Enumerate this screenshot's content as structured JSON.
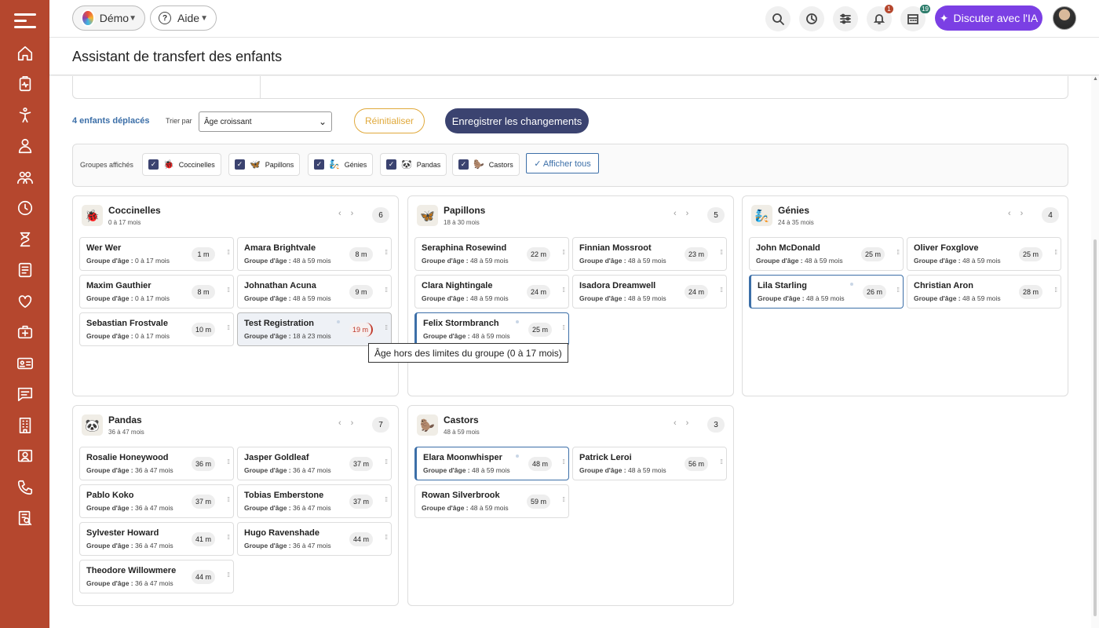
{
  "header": {
    "workspace": "Démo",
    "help": "Aide",
    "ai_button": "Discuter avec l'IA",
    "notifications_badge": "1",
    "calendar_badge": "19"
  },
  "page": {
    "title": "Assistant de transfert des enfants"
  },
  "actions": {
    "moved_count": "4 enfants déplacés",
    "sort_label": "Trier par",
    "sort_value": "Âge croissant",
    "reset": "Réinitialiser",
    "save": "Enregistrer les changements"
  },
  "filters": {
    "label": "Groupes affichés",
    "chips": [
      {
        "label": "Coccinelles",
        "emoji": "🐞"
      },
      {
        "label": "Papillons",
        "emoji": "🦋"
      },
      {
        "label": "Génies",
        "emoji": "🧞"
      },
      {
        "label": "Pandas",
        "emoji": "🐼"
      },
      {
        "label": "Castors",
        "emoji": "🦫"
      }
    ],
    "show_all": "✓ Afficher tous"
  },
  "group_prefix": "Groupe d'âge : ",
  "groups": [
    {
      "name": "Coccinelles",
      "emoji": "🐞",
      "age": "0 à 17 mois",
      "count": "6",
      "children": [
        {
          "name": "Wer Wer",
          "group": "0 à 17 mois",
          "age": "1 m"
        },
        {
          "name": "Amara Brightvale",
          "group": "48 à 59 mois",
          "age": "8 m"
        },
        {
          "name": "Maxim Gauthier",
          "group": "0 à 17 mois",
          "age": "8 m"
        },
        {
          "name": "Johnathan Acuna",
          "group": "48 à 59 mois",
          "age": "9 m"
        },
        {
          "name": "Sebastian Frostvale",
          "group": "0 à 17 mois",
          "age": "10 m"
        },
        {
          "name": "Test Registration",
          "group": "18 à 23 mois",
          "age": "19 m"
        }
      ]
    },
    {
      "name": "Papillons",
      "emoji": "🦋",
      "age": "18 à 30 mois",
      "count": "5",
      "children": [
        {
          "name": "Seraphina Rosewind",
          "group": "48 à 59 mois",
          "age": "22 m"
        },
        {
          "name": "Finnian Mossroot",
          "group": "48 à 59 mois",
          "age": "23 m"
        },
        {
          "name": "Clara Nightingale",
          "group": "48 à 59 mois",
          "age": "24 m"
        },
        {
          "name": "Isadora Dreamwell",
          "group": "48 à 59 mois",
          "age": "24 m"
        },
        {
          "name": "Felix Stormbranch",
          "group": "48 à 59 mois",
          "age": "25 m"
        }
      ]
    },
    {
      "name": "Génies",
      "emoji": "🧞",
      "age": "24 à 35 mois",
      "count": "4",
      "children": [
        {
          "name": "John McDonald",
          "group": "48 à 59 mois",
          "age": "25 m"
        },
        {
          "name": "Oliver Foxglove",
          "group": "48 à 59 mois",
          "age": "25 m"
        },
        {
          "name": "Lila Starling",
          "group": "48 à 59 mois",
          "age": "26 m"
        },
        {
          "name": "Christian Aron",
          "group": "48 à 59 mois",
          "age": "28 m"
        }
      ]
    },
    {
      "name": "Pandas",
      "emoji": "🐼",
      "age": "36 à 47 mois",
      "count": "7",
      "children": [
        {
          "name": "Rosalie Honeywood",
          "group": "36 à 47 mois",
          "age": "36 m"
        },
        {
          "name": "Jasper Goldleaf",
          "group": "36 à 47 mois",
          "age": "37 m"
        },
        {
          "name": "Pablo Koko",
          "group": "36 à 47 mois",
          "age": "37 m"
        },
        {
          "name": "Tobias Emberstone",
          "group": "36 à 47 mois",
          "age": "37 m"
        },
        {
          "name": "Sylvester Howard",
          "group": "36 à 47 mois",
          "age": "41 m"
        },
        {
          "name": "Hugo Ravenshade",
          "group": "36 à 47 mois",
          "age": "44 m"
        },
        {
          "name": "Theodore Willowmere",
          "group": "36 à 47 mois",
          "age": "44 m"
        }
      ]
    },
    {
      "name": "Castors",
      "emoji": "🦫",
      "age": "48 à 59 mois",
      "count": "3",
      "children": [
        {
          "name": "Elara Moonwhisper",
          "group": "48 à 59 mois",
          "age": "48 m"
        },
        {
          "name": "Patrick Leroi",
          "group": "48 à 59 mois",
          "age": "56 m"
        },
        {
          "name": "Rowan Silverbrook",
          "group": "48 à 59 mois",
          "age": "59 m"
        }
      ]
    }
  ],
  "tooltip": "Âge hors des limites du groupe (0 à 17 mois)"
}
